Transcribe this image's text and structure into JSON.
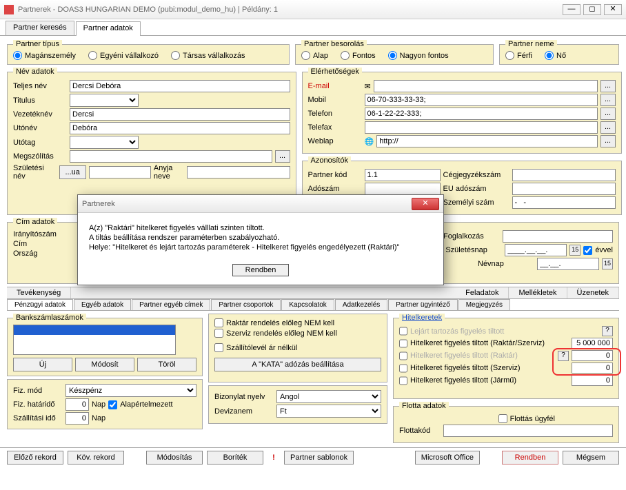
{
  "window": {
    "title": "Partnerek - DOAS3 HUNGARIAN DEMO (pubi:modul_demo_hu) | Példány: 1"
  },
  "mainTabs": {
    "t0": "Partner keresés",
    "t1": "Partner adatok"
  },
  "partnerType": {
    "legend": "Partner típus",
    "o0": "Magánszemély",
    "o1": "Egyéni vállalkozó",
    "o2": "Társas vállalkozás"
  },
  "besorolas": {
    "legend": "Partner besorolás",
    "o0": "Alap",
    "o1": "Fontos",
    "o2": "Nagyon fontos"
  },
  "nem": {
    "legend": "Partner neme",
    "o0": "Férfi",
    "o1": "Nő"
  },
  "nev": {
    "legend": "Név adatok",
    "teljes_lbl": "Teljes név",
    "teljes": "Dercsi Debóra",
    "titulus_lbl": "Titulus",
    "vezetek_lbl": "Vezetéknév",
    "vezetek": "Dercsi",
    "uto_lbl": "Utónév",
    "uto": "Debóra",
    "utotag_lbl": "Utótag",
    "megszol_lbl": "Megszólítás",
    "szul_lbl": "Születési név",
    "szul_btn": "...ua",
    "anyja_lbl": "Anyja neve"
  },
  "eler": {
    "legend": "Elérhetőségek",
    "email_lbl": "E-mail",
    "mobil_lbl": "Mobil",
    "mobil": "06-70-333-33-33;",
    "telefon_lbl": "Telefon",
    "telefon": "06-1-22-22-333;",
    "telefax_lbl": "Telefax",
    "weblap_lbl": "Weblap",
    "weblap": "http://"
  },
  "azon": {
    "legend": "Azonosítók",
    "kod_lbl": "Partner kód",
    "kod": "1.1",
    "ado_lbl": "Adószám",
    "cegj_lbl": "Cégjegyzékszám",
    "eu_lbl": "EU adószám",
    "szem_lbl": "Személyi szám",
    "szem": "-   -"
  },
  "cim": {
    "legend": "Cím adatok",
    "irsz_lbl": "Irányítószám",
    "cim_lbl": "Cím",
    "orszag_lbl": "Ország"
  },
  "misc": {
    "fogl_lbl": "Foglalkozás",
    "szul_lbl": "Születésnap",
    "szul": "____.__.__.",
    "evvel_lbl": "évvel",
    "nev_lbl": "Névnap",
    "nev": "__.__."
  },
  "midtabs": {
    "t0": "Tevékenység",
    "t4": "Feladatok",
    "t5": "Mellékletek",
    "t6": "Üzenetek"
  },
  "lowtabs": {
    "t0": "Pénzügyi adatok",
    "t1": "Egyéb adatok",
    "t2": "Partner egyéb címek",
    "t3": "Partner csoportok",
    "t4": "Kapcsolatok",
    "t5": "Adatkezelés",
    "t6": "Partner ügyintéző",
    "t7": "Megjegyzés"
  },
  "bank": {
    "legend": "Bankszámlaszámok",
    "uj": "Új",
    "mod": "Módosít",
    "torol": "Töröl"
  },
  "check1": "Raktár rendelés előleg NEM kell",
  "check2": "Szerviz rendelés előleg NEM kell",
  "check3": "Szállítólevél ár nélkül",
  "kata": "A \"KATA\" adózás beállítása",
  "fiz": {
    "mod_lbl": "Fiz. mód",
    "mod": "Készpénz",
    "hat_lbl": "Fiz. határidő",
    "hat": "0",
    "nap": "Nap",
    "alap": "Alapértelmezett",
    "szall_lbl": "Szállítási idő",
    "szall": "0"
  },
  "biz": {
    "nyelv_lbl": "Bizonylat nyelv",
    "nyelv": "Angol",
    "dev_lbl": "Devizanem",
    "dev": "Ft"
  },
  "hitel": {
    "legend": "Hitelkeretek",
    "r0": "Lejárt tartozás figyelés tiltott",
    "r1": "Hitelkeret figyelés tiltott (Raktár/Szerviz)",
    "v1": "5 000 000",
    "r2": "Hitelkeret figyelés tiltott (Raktár)",
    "v2": "0",
    "r3": "Hitelkeret figyelés tiltott (Szerviz)",
    "v3": "0",
    "r4": "Hitelkeret figyelés tiltott (Jármű)",
    "v4": "0"
  },
  "flotta": {
    "legend": "Flotta adatok",
    "ugy": "Flottás ügyfél",
    "kod_lbl": "Flottakód"
  },
  "bottom": {
    "prev": "Előző rekord",
    "next": "Köv. rekord",
    "mod": "Módosítás",
    "bor": "Boríték",
    "sab": "Partner sablonok",
    "off": "Microsoft Office",
    "ok": "Rendben",
    "cancel": "Mégsem"
  },
  "modal": {
    "title": "Partnerek",
    "l1": "A(z) \"Raktári\" hitelkeret figyelés válllati szinten tiltott.",
    "l2": "A tiltás beállítása rendszer paraméterben szabályozható.",
    "l3": "Helye: \"Hitelkeret és lejárt tartozás paraméterek - Hitelkeret figyelés engedélyezett (Raktári)\"",
    "ok": "Rendben"
  }
}
